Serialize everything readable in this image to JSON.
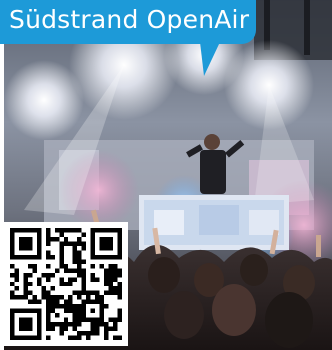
{
  "banner": {
    "title": "Südstrand OpenAir",
    "color": "#1d9ad8"
  },
  "photo": {
    "subject": "concert-crowd-photo"
  },
  "qr": {
    "icon": "qr-code-icon"
  }
}
